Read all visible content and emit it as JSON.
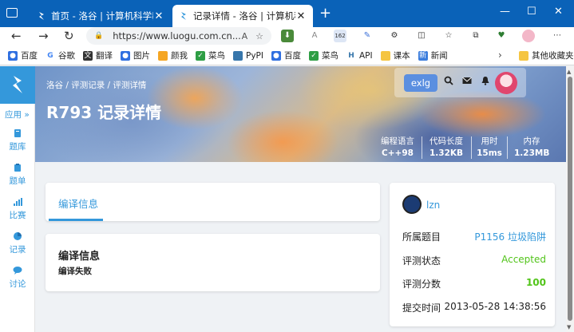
{
  "browser": {
    "tabs": [
      {
        "title": "首页 - 洛谷 | 计算机科学教育新生",
        "active": false
      },
      {
        "title": "记录详情 - 洛谷 | 计算机科学教育",
        "active": true
      }
    ],
    "url": "https://www.luogu.com.cn...",
    "bookmarks": [
      "百度",
      "谷歌",
      "翻译",
      "图片",
      "颜我",
      "菜鸟",
      "PyPI",
      "百度",
      "菜鸟",
      "API",
      "课本",
      "新闻"
    ],
    "other_bookmarks": "其他收藏夹",
    "ext_badge": "162",
    "reader_label": "A"
  },
  "sidebar": {
    "apps_label": "应用 »",
    "items": [
      {
        "label": "题库",
        "icon": "book-icon"
      },
      {
        "label": "题单",
        "icon": "clipboard-icon"
      },
      {
        "label": "比赛",
        "icon": "bar-chart-icon"
      },
      {
        "label": "记录",
        "icon": "pie-chart-icon"
      },
      {
        "label": "讨论",
        "icon": "chat-icon"
      }
    ]
  },
  "header": {
    "breadcrumb": "洛谷 / 评测记录 / 评测详情",
    "title": "R793 记录详情",
    "exlg_label": "exlg",
    "stats": [
      {
        "label": "编程语言",
        "value": "C++98"
      },
      {
        "label": "代码长度",
        "value": "1.32KB"
      },
      {
        "label": "用时",
        "value": "15ms"
      },
      {
        "label": "内存",
        "value": "1.23MB"
      }
    ]
  },
  "main": {
    "tab_label": "编译信息",
    "compile_heading": "编译信息",
    "compile_result": "编译失败"
  },
  "record": {
    "username": "lzn",
    "fields": [
      {
        "key": "所属题目",
        "value": "P1156 垃圾陷阱",
        "color": "#3498db",
        "bold": false
      },
      {
        "key": "评测状态",
        "value": "Accepted",
        "color": "#52c41a",
        "bold": false
      },
      {
        "key": "评测分数",
        "value": "100",
        "color": "#52c41a",
        "bold": true
      },
      {
        "key": "提交时间",
        "value": "2013-05-28 14:38:56",
        "color": "#222222",
        "bold": false
      }
    ]
  },
  "colors": {
    "brand": "#3498db",
    "browser_frame": "#0a62b8",
    "accepted": "#52c41a"
  }
}
